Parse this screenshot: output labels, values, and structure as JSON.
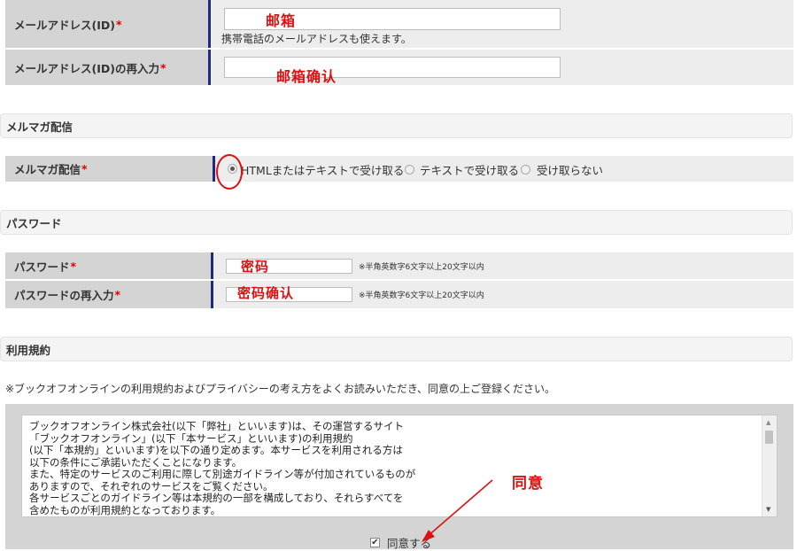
{
  "email": {
    "label": "メールアドレス(ID)",
    "confirm_label": "メールアドレス(ID)の再入力",
    "required_mark": "*",
    "note": "携帯電話のメールアドレスも使えます。",
    "annotation": "邮箱",
    "confirm_annotation": "邮箱确认"
  },
  "mailmag": {
    "section_title": "メルマガ配信",
    "label": "メルマガ配信",
    "options": [
      "HTMLまたはテキストで受け取る",
      "テキストで受け取る",
      "受け取らない"
    ],
    "selected_index": 0
  },
  "password": {
    "section_title": "パスワード",
    "label": "パスワード",
    "confirm_label": "パスワードの再入力",
    "hint": "※半角英数字6文字以上20文字以内",
    "annotation": "密码",
    "confirm_annotation": "密码确认"
  },
  "terms": {
    "section_title": "利用規約",
    "notice": "※ブックオフオンラインの利用規約およびプライバシーの考え方をよくお読みいただき、同意の上ご登録ください。",
    "lines": [
      "ブックオフオンライン株式会社(以下「弊社」といいます)は、その運営するサイト",
      "「ブックオフオンライン」(以下「本サービス」といいます)の利用規約",
      "(以下「本規約」といいます)を以下の通り定めます。本サービスを利用される方は",
      "以下の条件にご承諾いただくことになります。",
      "また、特定のサービスのご利用に際して別途ガイドライン等が付加されているものが",
      "ありますので、それぞれのサービスをご覧ください。",
      "各サービスごとのガイドライン等は本規約の一部を構成しており、それらすべてを",
      "含めたものが利用規約となっております。"
    ],
    "agree_label": "同意する",
    "agree_checked": true,
    "annotation": "同意"
  },
  "colors": {
    "annotation": "#dd1111",
    "required": "#dd0000",
    "label_bg": "#d4d4d4",
    "accent_bar": "#1e2a7a"
  }
}
